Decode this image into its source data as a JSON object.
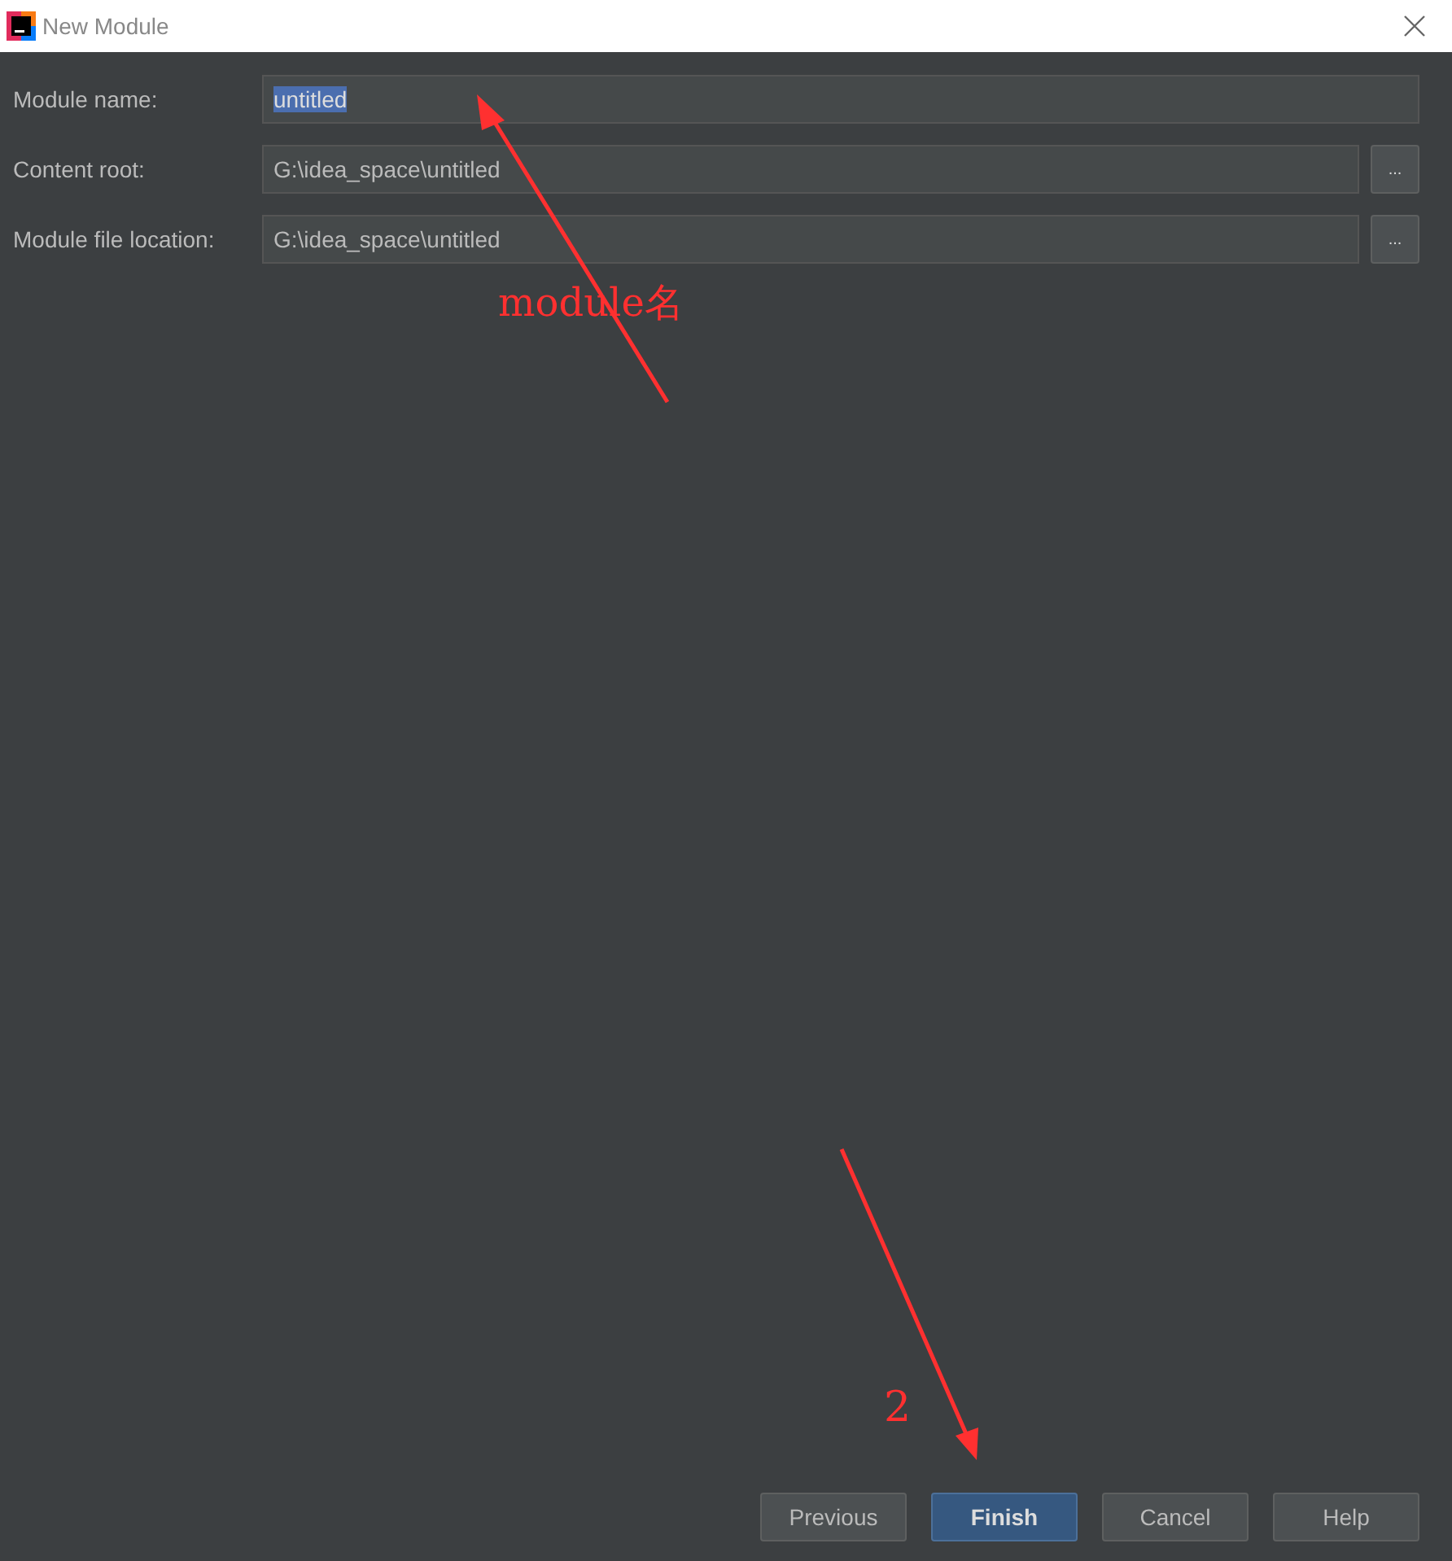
{
  "window": {
    "title": "New Module"
  },
  "fields": [
    {
      "label": "Module name:",
      "value": "untitled",
      "text_selected": true,
      "browse": false
    },
    {
      "label": "Content root:",
      "value": "G:\\idea_space\\untitled",
      "text_selected": false,
      "browse": true,
      "browse_label": "..."
    },
    {
      "label": "Module file location:",
      "value": "G:\\idea_space\\untitled",
      "text_selected": false,
      "browse": true,
      "browse_label": "..."
    }
  ],
  "buttons": [
    {
      "label": "Previous",
      "default": false
    },
    {
      "label": "Finish",
      "default": true
    },
    {
      "label": "Cancel",
      "default": false
    },
    {
      "label": "Help",
      "default": false
    }
  ],
  "annotations": [
    {
      "text": "module名"
    },
    {
      "text": "2"
    }
  ]
}
